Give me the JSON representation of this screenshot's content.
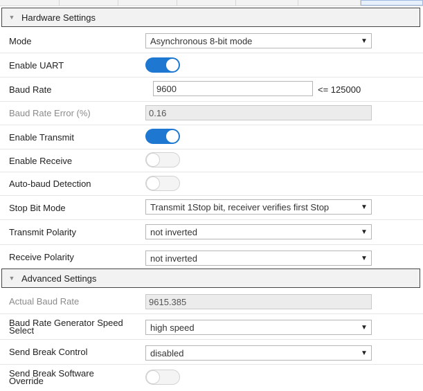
{
  "hardware": {
    "title": "Hardware Settings",
    "mode": {
      "label": "Mode",
      "value": "Asynchronous 8-bit mode"
    },
    "enable_uart": {
      "label": "Enable UART",
      "state": "on"
    },
    "baud_rate": {
      "label": "Baud Rate",
      "value": "9600",
      "limit": "<= 125000"
    },
    "baud_rate_error": {
      "label": "Baud Rate Error (%)",
      "value": "0.16"
    },
    "enable_transmit": {
      "label": "Enable Transmit",
      "state": "on"
    },
    "enable_receive": {
      "label": "Enable Receive",
      "state": "off"
    },
    "auto_baud": {
      "label": "Auto-baud Detection",
      "state": "off"
    },
    "stop_bit": {
      "label": "Stop Bit Mode",
      "value": "Transmit 1Stop bit, receiver verifies first Stop"
    },
    "tx_polarity": {
      "label": "Transmit Polarity",
      "value": "not inverted"
    },
    "rx_polarity": {
      "label": "Receive Polarity",
      "value": "not inverted"
    }
  },
  "advanced": {
    "title": "Advanced Settings",
    "actual_baud": {
      "label": "Actual Baud Rate",
      "value": "9615.385"
    },
    "brg_speed": {
      "label_line1": "Baud Rate Generator Speed",
      "label_line2": "Select",
      "value": "high speed"
    },
    "send_break": {
      "label": "Send Break Control",
      "value": "disabled"
    },
    "send_break_override": {
      "label_line1": "Send Break Software",
      "label_line2": "Override",
      "state": "off"
    }
  },
  "colors": {
    "toggle_on": "#1e78d2",
    "header_bg": "#f2f2f2"
  },
  "icons": {
    "expand": "triangle-down-icon",
    "dropdown": "dropdown-arrow-icon"
  }
}
